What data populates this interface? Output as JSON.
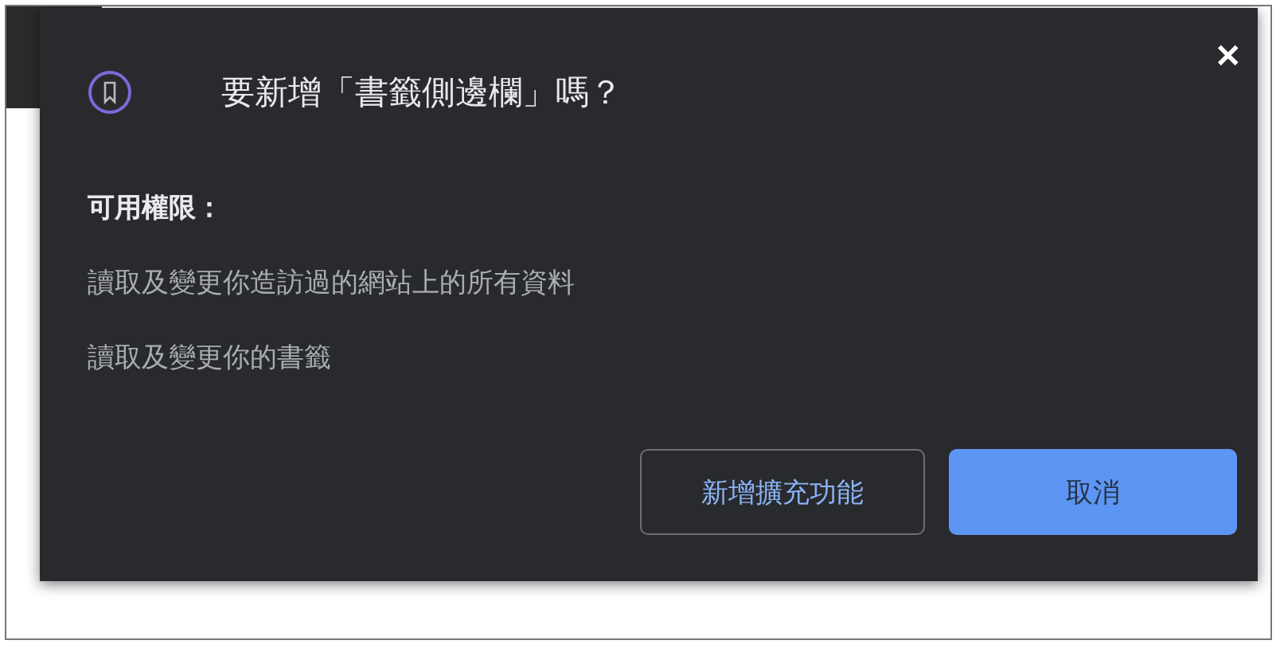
{
  "dialog": {
    "title": "要新增「書籤側邊欄」嗎？",
    "permissions_heading": "可用權限：",
    "permissions": [
      "讀取及變更你造訪過的網站上的所有資料",
      "讀取及變更你的書籤"
    ],
    "close": "✕",
    "buttons": [
      {
        "label": "新增擴充功能",
        "kind": "outline"
      },
      {
        "label": "取消",
        "kind": "primary"
      }
    ]
  }
}
